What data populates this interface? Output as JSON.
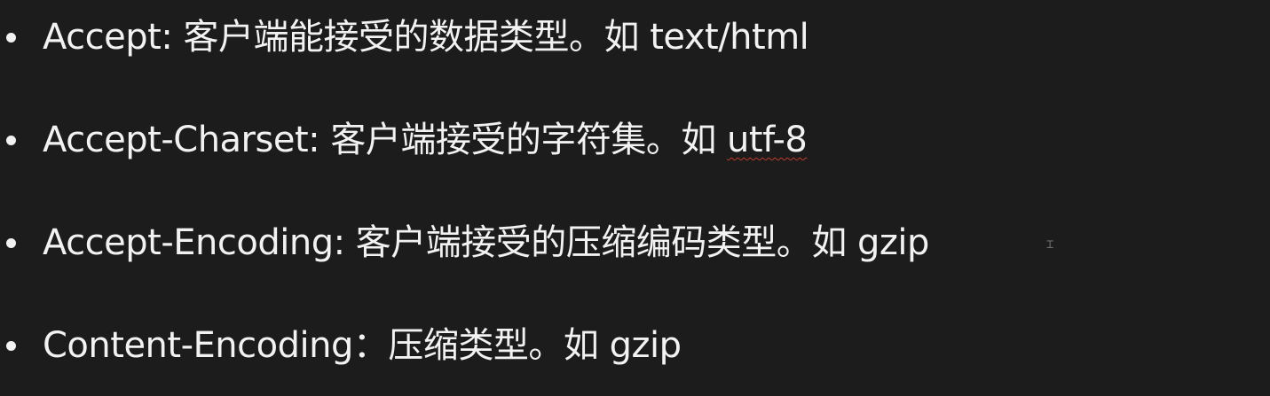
{
  "slide": {
    "items": [
      {
        "term": "Accept:",
        "description": "客户端能接受的数据类型。如",
        "example": "text/html"
      },
      {
        "term": "Accept-Charset:",
        "description": "客户端接受的字符集。如",
        "example": "utf-8"
      },
      {
        "term": "Accept-Encoding:",
        "description": "客户端接受的压缩编码类型。如",
        "example": "gzip"
      },
      {
        "term": "Content-Encoding：",
        "description": "压缩类型。如",
        "example": "gzip"
      }
    ]
  },
  "colors": {
    "background": "#1c1c1c",
    "text": "#f2f2f2",
    "spellcheck_underline": "#c0392b"
  },
  "icons": {
    "text_cursor": "i-beam-cursor-icon"
  }
}
